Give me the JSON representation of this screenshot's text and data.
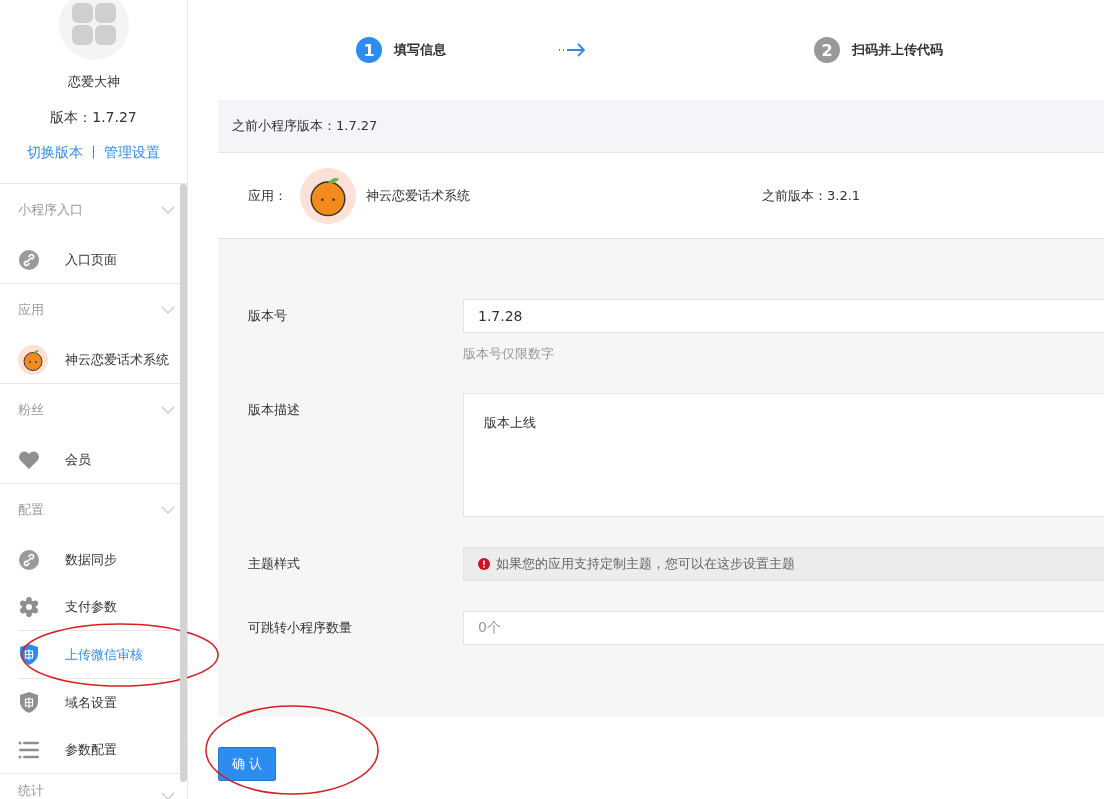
{
  "profile": {
    "name": "恋爱大神",
    "version": "版本：1.7.27",
    "links": [
      "切换版本",
      "管理设置"
    ],
    "separator": "|"
  },
  "menu": [
    {
      "title": "小程序入口",
      "items": [
        {
          "label": "入口页面",
          "kind": "link",
          "selected": false
        }
      ]
    },
    {
      "title": "应用",
      "items": [
        {
          "label": "神云恋爱话术系统",
          "kind": "app",
          "selected": false
        }
      ]
    },
    {
      "title": "粉丝",
      "items": [
        {
          "label": "会员",
          "kind": "heart",
          "selected": false
        }
      ]
    },
    {
      "title": "配置",
      "items": [
        {
          "label": "数据同步",
          "kind": "link",
          "selected": false
        },
        {
          "label": "支付参数",
          "kind": "gear",
          "selected": false
        },
        {
          "label": "上传微信审核",
          "kind": "shield",
          "selected": true
        },
        {
          "label": "域名设置",
          "kind": "shield",
          "selected": false
        },
        {
          "label": "参数配置",
          "kind": "list",
          "selected": false
        }
      ]
    },
    {
      "title": "统计"
    }
  ],
  "steps": [
    {
      "number": "1",
      "label": "填写信息",
      "active": true
    },
    {
      "number": "2",
      "label": "扫码并上传代码",
      "active": false
    }
  ],
  "previous_mini_program_version": "之前小程序版本：1.7.27",
  "app_row": {
    "label": "应用：",
    "name": "神云恋爱话术系统",
    "previous_version": "之前版本：3.2.1"
  },
  "form": {
    "version_label": "版本号",
    "version_value": "1.7.28",
    "version_hint": "版本号仅限数字",
    "description_label": "版本描述",
    "description_value": "版本上线",
    "theme_label": "主题样式",
    "theme_notice": "如果您的应用支持定制主题，您可以在这步设置主题",
    "jump_label": "可跳转小程序数量",
    "jump_value": "0个"
  },
  "confirm_button": "确 认"
}
